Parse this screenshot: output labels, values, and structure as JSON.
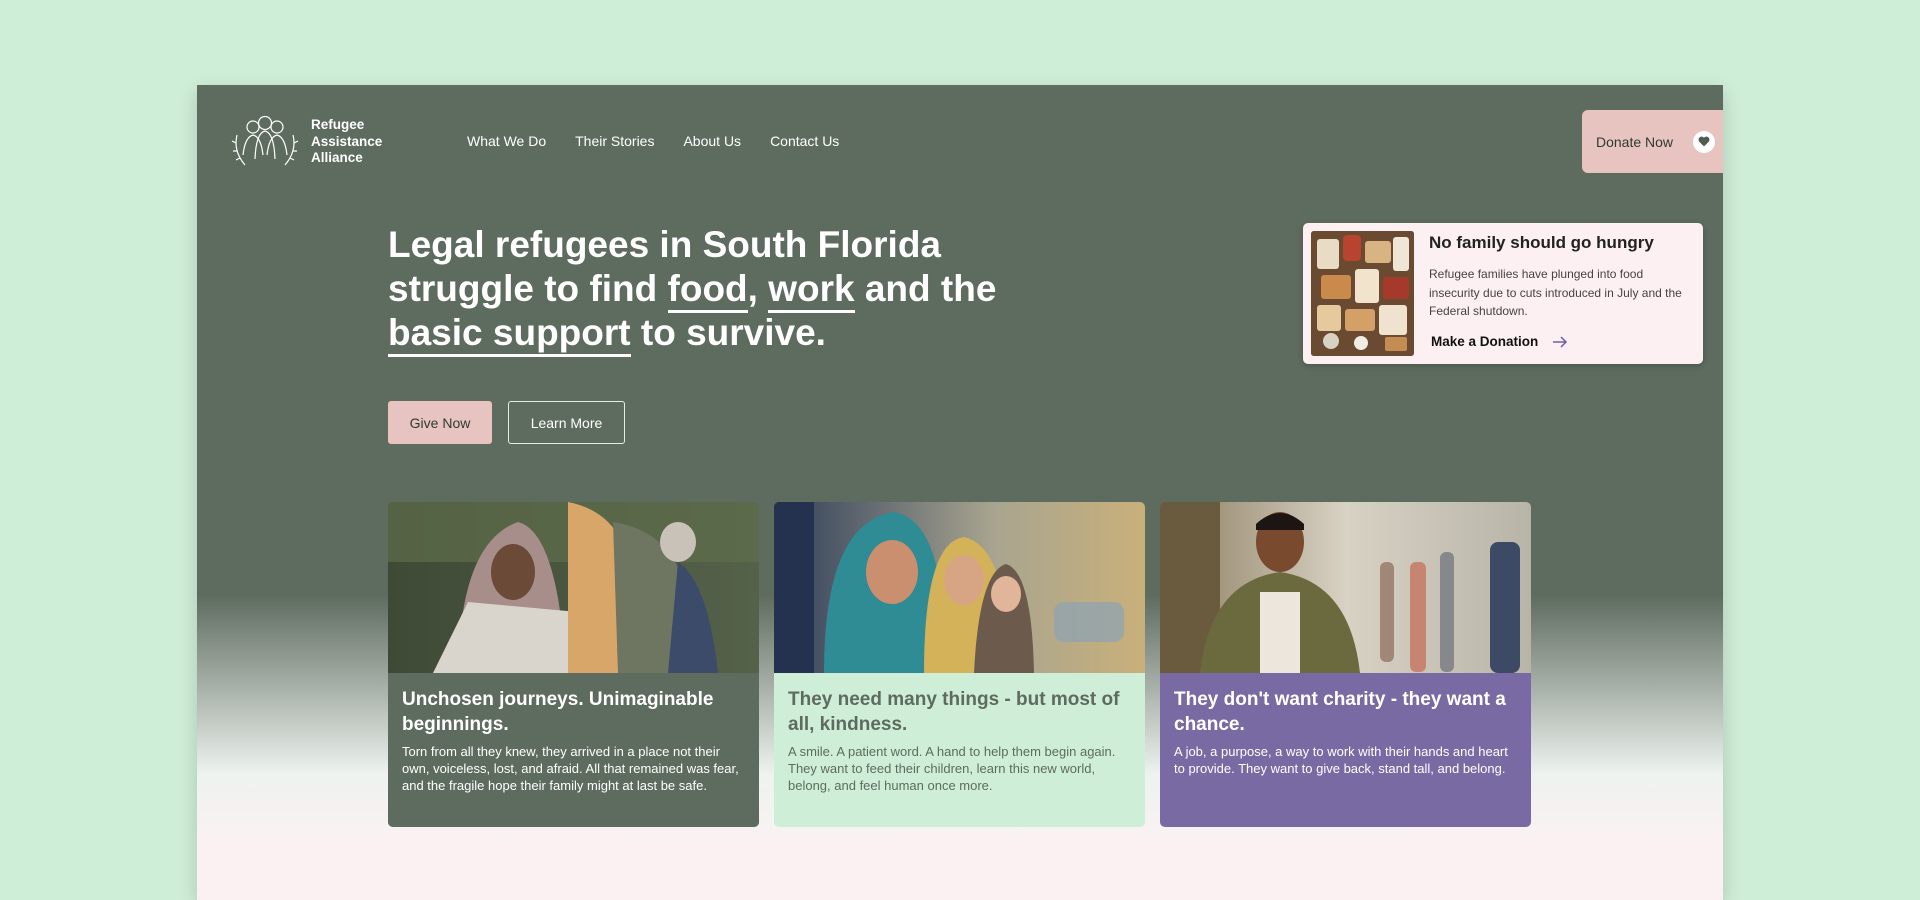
{
  "brand": {
    "lines": [
      "Refugee",
      "Assistance",
      "Alliance"
    ]
  },
  "nav": {
    "items": [
      "What We Do",
      "Their Stories",
      "About Us",
      "Contact Us"
    ]
  },
  "header": {
    "donate_label": "Donate Now"
  },
  "hero": {
    "line1": "Legal refugees in South Florida",
    "line2_pre": "struggle to find ",
    "word_food": "food",
    "comma": ",",
    "word_work": "work",
    "line2_post": " and the",
    "phrase_support": "basic support",
    "line3_post": " to survive.",
    "give_label": "Give Now",
    "learn_label": "Learn More"
  },
  "promo": {
    "title": "No family should go hungry",
    "text": "Refugee families have plunged into food insecurity due to cuts introduced in July and the Federal shutdown.",
    "link_label": "Make a Donation"
  },
  "cards": [
    {
      "title": "Unchosen journeys. Unimaginable beginnings.",
      "text": "Torn from all they knew, they arrived in a place not their own, voiceless, lost, and afraid. All that remained was fear, and the fragile hope their family might at last be safe."
    },
    {
      "title": "They need many things - but most of all, kindness.",
      "text": "A smile. A patient word. A hand to help them begin again. They want to feed their children, learn this new world, belong, and feel human once more."
    },
    {
      "title": "They don't want charity - they want a chance.",
      "text": "A job, a purpose, a way to work with their hands and heart to provide. They want to give back, stand tall, and belong."
    }
  ],
  "colors": {
    "page_bg": "#cfeed8",
    "frame_green": "#5e6b5f",
    "pink": "#e8c4c0",
    "purple": "#7a6aa3",
    "mint": "#cfeed8"
  },
  "icons": [
    "family-logo-icon",
    "heart-icon",
    "arrow-right-icon"
  ]
}
